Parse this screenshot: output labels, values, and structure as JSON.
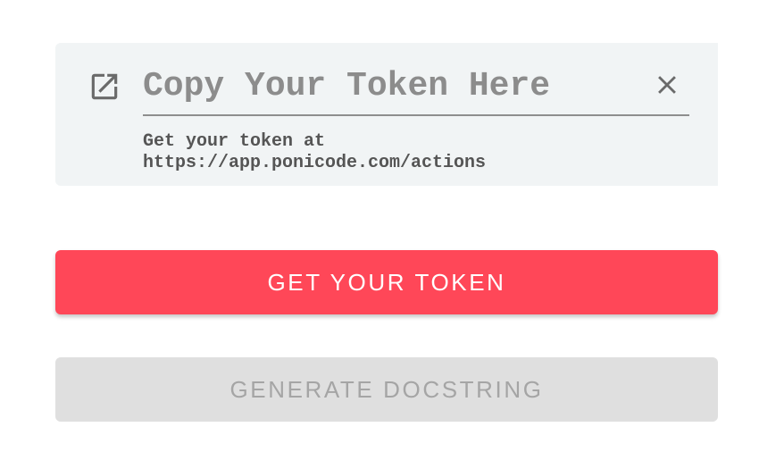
{
  "token_section": {
    "input_placeholder": "Copy Your Token Here",
    "input_value": "",
    "helper_line1": "Get your token at",
    "helper_line2": "https://app.ponicode.com/actions",
    "open_link_icon": "open-in-new-icon",
    "clear_icon": "close-icon"
  },
  "actions": {
    "get_token_label": "GET YOUR TOKEN",
    "generate_docstring_label": "GENERATE DOCSTRING",
    "generate_docstring_disabled": true
  },
  "colors": {
    "card_background": "#f1f4f5",
    "primary_button": "#ff4758",
    "disabled_button": "#dfdfdf",
    "disabled_text": "#a5a5a5",
    "icon": "#6a6a6a"
  }
}
